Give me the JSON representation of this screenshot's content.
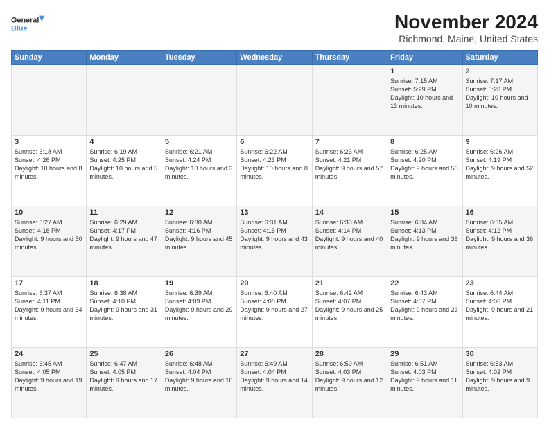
{
  "logo": {
    "line1": "General",
    "line2": "Blue"
  },
  "title": "November 2024",
  "subtitle": "Richmond, Maine, United States",
  "header_color": "#4a7fc1",
  "days_of_week": [
    "Sunday",
    "Monday",
    "Tuesday",
    "Wednesday",
    "Thursday",
    "Friday",
    "Saturday"
  ],
  "weeks": [
    [
      {
        "day": "",
        "info": ""
      },
      {
        "day": "",
        "info": ""
      },
      {
        "day": "",
        "info": ""
      },
      {
        "day": "",
        "info": ""
      },
      {
        "day": "",
        "info": ""
      },
      {
        "day": "1",
        "info": "Sunrise: 7:15 AM\nSunset: 5:29 PM\nDaylight: 10 hours and 13 minutes."
      },
      {
        "day": "2",
        "info": "Sunrise: 7:17 AM\nSunset: 5:28 PM\nDaylight: 10 hours and 10 minutes."
      }
    ],
    [
      {
        "day": "3",
        "info": "Sunrise: 6:18 AM\nSunset: 4:26 PM\nDaylight: 10 hours and 8 minutes."
      },
      {
        "day": "4",
        "info": "Sunrise: 6:19 AM\nSunset: 4:25 PM\nDaylight: 10 hours and 5 minutes."
      },
      {
        "day": "5",
        "info": "Sunrise: 6:21 AM\nSunset: 4:24 PM\nDaylight: 10 hours and 3 minutes."
      },
      {
        "day": "6",
        "info": "Sunrise: 6:22 AM\nSunset: 4:23 PM\nDaylight: 10 hours and 0 minutes."
      },
      {
        "day": "7",
        "info": "Sunrise: 6:23 AM\nSunset: 4:21 PM\nDaylight: 9 hours and 57 minutes."
      },
      {
        "day": "8",
        "info": "Sunrise: 6:25 AM\nSunset: 4:20 PM\nDaylight: 9 hours and 55 minutes."
      },
      {
        "day": "9",
        "info": "Sunrise: 6:26 AM\nSunset: 4:19 PM\nDaylight: 9 hours and 52 minutes."
      }
    ],
    [
      {
        "day": "10",
        "info": "Sunrise: 6:27 AM\nSunset: 4:18 PM\nDaylight: 9 hours and 50 minutes."
      },
      {
        "day": "11",
        "info": "Sunrise: 6:29 AM\nSunset: 4:17 PM\nDaylight: 9 hours and 47 minutes."
      },
      {
        "day": "12",
        "info": "Sunrise: 6:30 AM\nSunset: 4:16 PM\nDaylight: 9 hours and 45 minutes."
      },
      {
        "day": "13",
        "info": "Sunrise: 6:31 AM\nSunset: 4:15 PM\nDaylight: 9 hours and 43 minutes."
      },
      {
        "day": "14",
        "info": "Sunrise: 6:33 AM\nSunset: 4:14 PM\nDaylight: 9 hours and 40 minutes."
      },
      {
        "day": "15",
        "info": "Sunrise: 6:34 AM\nSunset: 4:13 PM\nDaylight: 9 hours and 38 minutes."
      },
      {
        "day": "16",
        "info": "Sunrise: 6:35 AM\nSunset: 4:12 PM\nDaylight: 9 hours and 36 minutes."
      }
    ],
    [
      {
        "day": "17",
        "info": "Sunrise: 6:37 AM\nSunset: 4:11 PM\nDaylight: 9 hours and 34 minutes."
      },
      {
        "day": "18",
        "info": "Sunrise: 6:38 AM\nSunset: 4:10 PM\nDaylight: 9 hours and 31 minutes."
      },
      {
        "day": "19",
        "info": "Sunrise: 6:39 AM\nSunset: 4:09 PM\nDaylight: 9 hours and 29 minutes."
      },
      {
        "day": "20",
        "info": "Sunrise: 6:40 AM\nSunset: 4:08 PM\nDaylight: 9 hours and 27 minutes."
      },
      {
        "day": "21",
        "info": "Sunrise: 6:42 AM\nSunset: 4:07 PM\nDaylight: 9 hours and 25 minutes."
      },
      {
        "day": "22",
        "info": "Sunrise: 6:43 AM\nSunset: 4:07 PM\nDaylight: 9 hours and 23 minutes."
      },
      {
        "day": "23",
        "info": "Sunrise: 6:44 AM\nSunset: 4:06 PM\nDaylight: 9 hours and 21 minutes."
      }
    ],
    [
      {
        "day": "24",
        "info": "Sunrise: 6:45 AM\nSunset: 4:05 PM\nDaylight: 9 hours and 19 minutes."
      },
      {
        "day": "25",
        "info": "Sunrise: 6:47 AM\nSunset: 4:05 PM\nDaylight: 9 hours and 17 minutes."
      },
      {
        "day": "26",
        "info": "Sunrise: 6:48 AM\nSunset: 4:04 PM\nDaylight: 9 hours and 16 minutes."
      },
      {
        "day": "27",
        "info": "Sunrise: 6:49 AM\nSunset: 4:04 PM\nDaylight: 9 hours and 14 minutes."
      },
      {
        "day": "28",
        "info": "Sunrise: 6:50 AM\nSunset: 4:03 PM\nDaylight: 9 hours and 12 minutes."
      },
      {
        "day": "29",
        "info": "Sunrise: 6:51 AM\nSunset: 4:03 PM\nDaylight: 9 hours and 11 minutes."
      },
      {
        "day": "30",
        "info": "Sunrise: 6:53 AM\nSunset: 4:02 PM\nDaylight: 9 hours and 9 minutes."
      }
    ]
  ]
}
